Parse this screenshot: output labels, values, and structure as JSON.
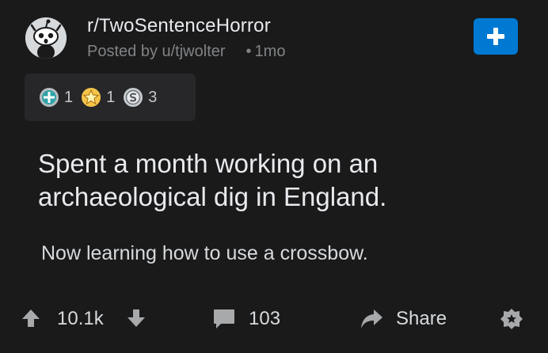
{
  "header": {
    "subreddit": "r/TwoSentenceHorror",
    "posted_by": "Posted by u/tjwolter",
    "age": "1mo",
    "separator": "•"
  },
  "awards": [
    {
      "icon": "helpful-award-icon",
      "count": "1"
    },
    {
      "icon": "star-award-icon",
      "count": "1"
    },
    {
      "icon": "silver-award-icon",
      "count": "3"
    }
  ],
  "post": {
    "title_line1": "Spent a month working on an",
    "title_line2": "archaeological dig in England.",
    "body": "Now learning how to use a crossbow."
  },
  "actions": {
    "upvote_count": "10.1k",
    "comments_count": "103",
    "share_label": "Share"
  },
  "colors": {
    "background": "#1a1a1b",
    "join_button": "#0079d3",
    "awards_panel": "#272729"
  }
}
